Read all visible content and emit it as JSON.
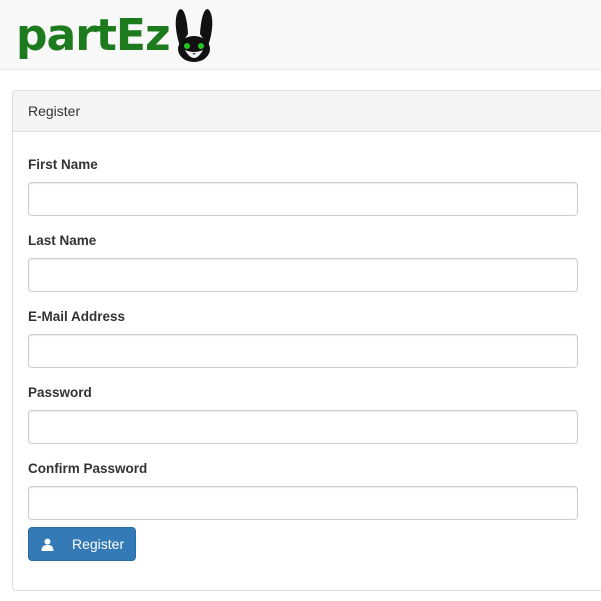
{
  "brand": {
    "name": "partEz",
    "logo_icon": "rabbit-head-icon",
    "color": "#1d7a1d"
  },
  "panel": {
    "heading": "Register"
  },
  "form": {
    "fields": [
      {
        "label": "First Name",
        "value": "",
        "type": "text"
      },
      {
        "label": "Last Name",
        "value": "",
        "type": "text"
      },
      {
        "label": "E-Mail Address",
        "value": "",
        "type": "email"
      },
      {
        "label": "Password",
        "value": "",
        "type": "password"
      },
      {
        "label": "Confirm Password",
        "value": "",
        "type": "password"
      }
    ],
    "submit": {
      "label": "Register",
      "icon": "user-icon",
      "color": "#337ab7"
    }
  }
}
